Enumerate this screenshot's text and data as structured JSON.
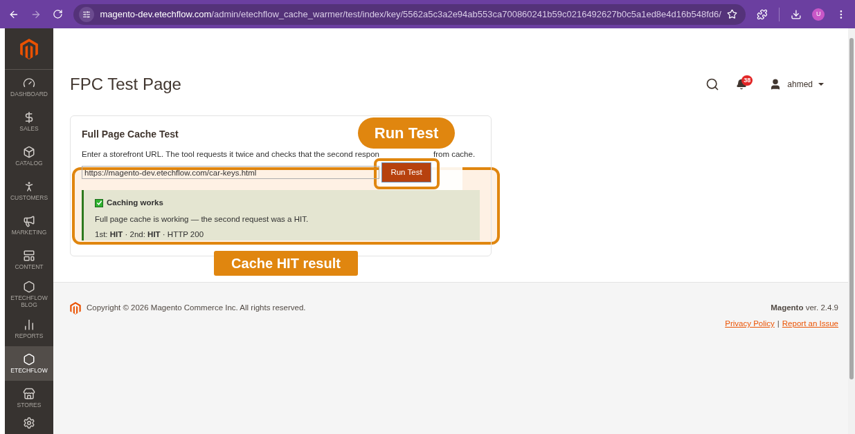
{
  "browser": {
    "url_host": "magento-dev.etechflow.com",
    "url_path": "/admin/etechflow_cache_warmer/test/index/key/5562a5c3a2e94ab553ca700860241b59c0216492627b0c5a1ed8e4d16b548fd6/",
    "profile": "U"
  },
  "sidebar": {
    "items": [
      {
        "label": "DASHBOARD",
        "selected": false
      },
      {
        "label": "SALES",
        "selected": false
      },
      {
        "label": "CATALOG",
        "selected": false
      },
      {
        "label": "CUSTOMERS",
        "selected": false
      },
      {
        "label": "MARKETING",
        "selected": false
      },
      {
        "label": "CONTENT",
        "selected": false
      },
      {
        "label": "ETECHFLOW BLOG",
        "selected": false
      },
      {
        "label": "REPORTS",
        "selected": false
      },
      {
        "label": "ETECHFLOW",
        "selected": true
      },
      {
        "label": "STORES",
        "selected": false
      }
    ]
  },
  "header": {
    "title": "FPC Test Page",
    "notifications": "38",
    "user": "ahmed"
  },
  "card": {
    "title": "Full Page Cache Test",
    "description_parts": [
      "Enter a storefront URL. The tool requests it twice and checks that the second respon",
      "from cache."
    ],
    "url_value": "https://magento-dev.etechflow.com/car-keys.html",
    "button": "Run Test",
    "result": {
      "title": "Caching works",
      "message": "Full page cache is working — the second request was a HIT.",
      "details": "1st: **HIT** · 2nd: **HIT** · HTTP 200"
    }
  },
  "annotations": [
    {
      "kind": "pill",
      "label": "Run Test"
    },
    {
      "kind": "tag",
      "label": "Cache HIT result"
    }
  ],
  "footer": {
    "copyright": "Copyright © 2026 Magento Commerce Inc. All rights reserved.",
    "brand": "Magento",
    "version": "ver. 2.4.9",
    "links": [
      {
        "label": "Privacy Policy"
      },
      {
        "label": "Report an Issue"
      }
    ],
    "separator": "|"
  }
}
